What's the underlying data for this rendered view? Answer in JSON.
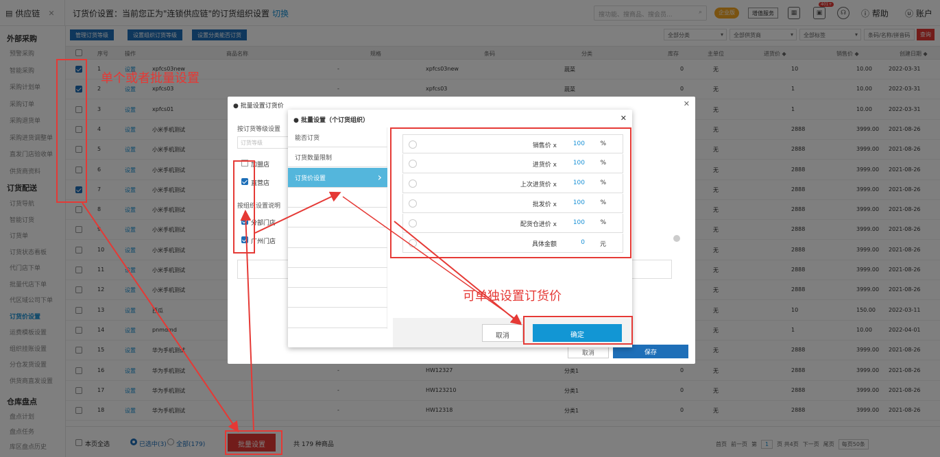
{
  "tab": {
    "label": "供应链"
  },
  "header": {
    "title": "订货价设置：当前您正为\"连锁供应链\"的订货组织设置",
    "switch": "切换",
    "search_placeholder": "搜功能、搜商品、搜会员...",
    "badge_enterprise": "企业版",
    "badge_service": "增值服务",
    "help": "帮助",
    "account": "账户",
    "badge_new": "401+"
  },
  "sidebar": {
    "sections": [
      {
        "label": "外部采购"
      },
      {
        "label": "订货配送"
      },
      {
        "label": "仓库盘点"
      }
    ],
    "purchase": [
      "预警采购",
      "智能采购",
      "采购计划单",
      "采购订单",
      "采购退货单",
      "采购进货调整单",
      "直发门店验收单",
      "供货商资料"
    ],
    "order": [
      "订货导航",
      "智能订货",
      "订货单",
      "订货状态看板",
      "代门店下单",
      "批量代店下单",
      "代区域公司下单",
      "订货价设置",
      "运费模板设置",
      "组织挂账设置",
      "分仓发货设置",
      "供货商直发设置"
    ],
    "stock": [
      "盘点计划",
      "盘点任务",
      "库区盘点历史"
    ]
  },
  "toolbar": {
    "btn1": "管理订货等级",
    "btn2": "设置组织订货等级",
    "btn3": "设置分类能否订货",
    "f1": "全部分类",
    "f2": "全部供货商",
    "f3": "全部标签",
    "f4": "条码/名称/拼音码",
    "query": "查询"
  },
  "table": {
    "headers": [
      "序号",
      "操作",
      "商品名称",
      "规格",
      "条码",
      "分类",
      "库存",
      "主单位",
      "进货价 ◆",
      "销售价 ◆",
      "创建日期 ◆"
    ],
    "rows": [
      {
        "no": "1",
        "op": "设置",
        "name": "xpfcs03new",
        "spec": "-",
        "code": "xpfcs03new",
        "cat": "蔬菜",
        "stock": "0",
        "unit": "无",
        "cost": "10",
        "price": "10.00",
        "date": "2022-03-31",
        "checked": true
      },
      {
        "no": "2",
        "op": "设置",
        "name": "xpfcs03",
        "spec": "-",
        "code": "xpfcs03",
        "cat": "蔬菜",
        "stock": "0",
        "unit": "无",
        "cost": "1",
        "price": "10.00",
        "date": "2022-03-31",
        "checked": true
      },
      {
        "no": "3",
        "op": "设置",
        "name": "xpfcs01",
        "spec": "",
        "code": "",
        "cat": "",
        "stock": "",
        "unit": "无",
        "cost": "1",
        "price": "10.00",
        "date": "2022-03-31",
        "checked": false
      },
      {
        "no": "4",
        "op": "设置",
        "name": "小米手机测试",
        "spec": "",
        "code": "",
        "cat": "",
        "stock": "",
        "unit": "无",
        "cost": "2888",
        "price": "3999.00",
        "date": "2021-08-26",
        "checked": false
      },
      {
        "no": "5",
        "op": "设置",
        "name": "小米手机测试",
        "spec": "",
        "code": "",
        "cat": "",
        "stock": "",
        "unit": "无",
        "cost": "2888",
        "price": "3999.00",
        "date": "2021-08-26",
        "checked": false
      },
      {
        "no": "6",
        "op": "设置",
        "name": "小米手机测试",
        "spec": "",
        "code": "",
        "cat": "",
        "stock": "",
        "unit": "无",
        "cost": "2888",
        "price": "3999.00",
        "date": "2021-08-26",
        "checked": false
      },
      {
        "no": "7",
        "op": "设置",
        "name": "小米手机测试",
        "spec": "",
        "code": "",
        "cat": "",
        "stock": "",
        "unit": "无",
        "cost": "2888",
        "price": "3999.00",
        "date": "2021-08-26",
        "checked": true
      },
      {
        "no": "8",
        "op": "设置",
        "name": "小米手机测试",
        "spec": "",
        "code": "",
        "cat": "",
        "stock": "",
        "unit": "无",
        "cost": "2888",
        "price": "3999.00",
        "date": "2021-08-26",
        "checked": false
      },
      {
        "no": "9",
        "op": "设置",
        "name": "小米手机测试",
        "spec": "",
        "code": "",
        "cat": "",
        "stock": "",
        "unit": "无",
        "cost": "2888",
        "price": "3999.00",
        "date": "2021-08-26",
        "checked": false
      },
      {
        "no": "10",
        "op": "设置",
        "name": "小米手机测试",
        "spec": "",
        "code": "",
        "cat": "",
        "stock": "",
        "unit": "无",
        "cost": "2888",
        "price": "3999.00",
        "date": "2021-08-26",
        "checked": false
      },
      {
        "no": "11",
        "op": "设置",
        "name": "小米手机测试",
        "spec": "",
        "code": "",
        "cat": "",
        "stock": "",
        "unit": "无",
        "cost": "2888",
        "price": "3999.00",
        "date": "2021-08-26",
        "checked": false
      },
      {
        "no": "12",
        "op": "设置",
        "name": "小米手机测试",
        "spec": "",
        "code": "",
        "cat": "",
        "stock": "",
        "unit": "无",
        "cost": "2888",
        "price": "3999.00",
        "date": "2021-08-26",
        "checked": false
      },
      {
        "no": "13",
        "op": "设置",
        "name": "西瓜",
        "spec": "",
        "code": "",
        "cat": "",
        "stock": "",
        "unit": "无",
        "cost": "10",
        "price": "150.00",
        "date": "2022-03-11",
        "checked": false
      },
      {
        "no": "14",
        "op": "设置",
        "name": "pnmdmd",
        "spec": "",
        "code": "",
        "cat": "",
        "stock": "",
        "unit": "无",
        "cost": "1",
        "price": "10.00",
        "date": "2022-04-01",
        "checked": false
      },
      {
        "no": "15",
        "op": "设置",
        "name": "华为手机测试",
        "spec": "",
        "code": "",
        "cat": "",
        "stock": "",
        "unit": "无",
        "cost": "2888",
        "price": "3999.00",
        "date": "2021-08-26",
        "checked": false
      },
      {
        "no": "16",
        "op": "设置",
        "name": "华为手机测试",
        "spec": "-",
        "code": "HW12327",
        "cat": "分类1",
        "stock": "0",
        "unit": "无",
        "cost": "2888",
        "price": "3999.00",
        "date": "2021-08-26",
        "checked": false
      },
      {
        "no": "17",
        "op": "设置",
        "name": "华为手机测试",
        "spec": "-",
        "code": "HW123210",
        "cat": "分类1",
        "stock": "0",
        "unit": "无",
        "cost": "2888",
        "price": "3999.00",
        "date": "2021-08-26",
        "checked": false
      },
      {
        "no": "18",
        "op": "设置",
        "name": "华为手机测试",
        "spec": "-",
        "code": "HW12318",
        "cat": "分类1",
        "stock": "0",
        "unit": "无",
        "cost": "2888",
        "price": "3999.00",
        "date": "2021-08-26",
        "checked": false
      }
    ]
  },
  "footer": {
    "select_page": "本页全选",
    "selected": "已选中(3)",
    "all": "全部(179)",
    "batch": "批量设置",
    "total": "共 179 种商品",
    "first": "首页",
    "prev": "前一页",
    "page_pre": "第",
    "page_num": "1",
    "page_suf": "页 共4页",
    "next": "下一页",
    "last": "尾页",
    "per_page": "每页50条"
  },
  "dialog1": {
    "title": "● 批量设置订货价",
    "by_level": "按订货等级设置",
    "level_ph": "订货等级",
    "opt1": "加盟店",
    "opt2": "直营店",
    "by_org": "按组织设置说明",
    "org1": "分部门店",
    "org2": "广州门店",
    "cancel": "取消",
    "save": "保存"
  },
  "dialog2": {
    "title": "● 批量设置（个订货组织）",
    "menu": [
      "能否订货",
      "订货数量限制",
      "订货价设置"
    ],
    "options": [
      {
        "label": "销售价 x",
        "value": "100",
        "unit": "%"
      },
      {
        "label": "进货价 x",
        "value": "100",
        "unit": "%"
      },
      {
        "label": "上次进货价 x",
        "value": "100",
        "unit": "%"
      },
      {
        "label": "批发价 x",
        "value": "100",
        "unit": "%"
      },
      {
        "label": "配货仓进价 x",
        "value": "100",
        "unit": "%"
      },
      {
        "label": "具体金额",
        "value": "0",
        "unit": "元"
      }
    ],
    "cancel": "取消",
    "ok": "确定"
  },
  "annotations": {
    "a1": "单个或者批量设置",
    "a2": "可单独设置订货价"
  }
}
